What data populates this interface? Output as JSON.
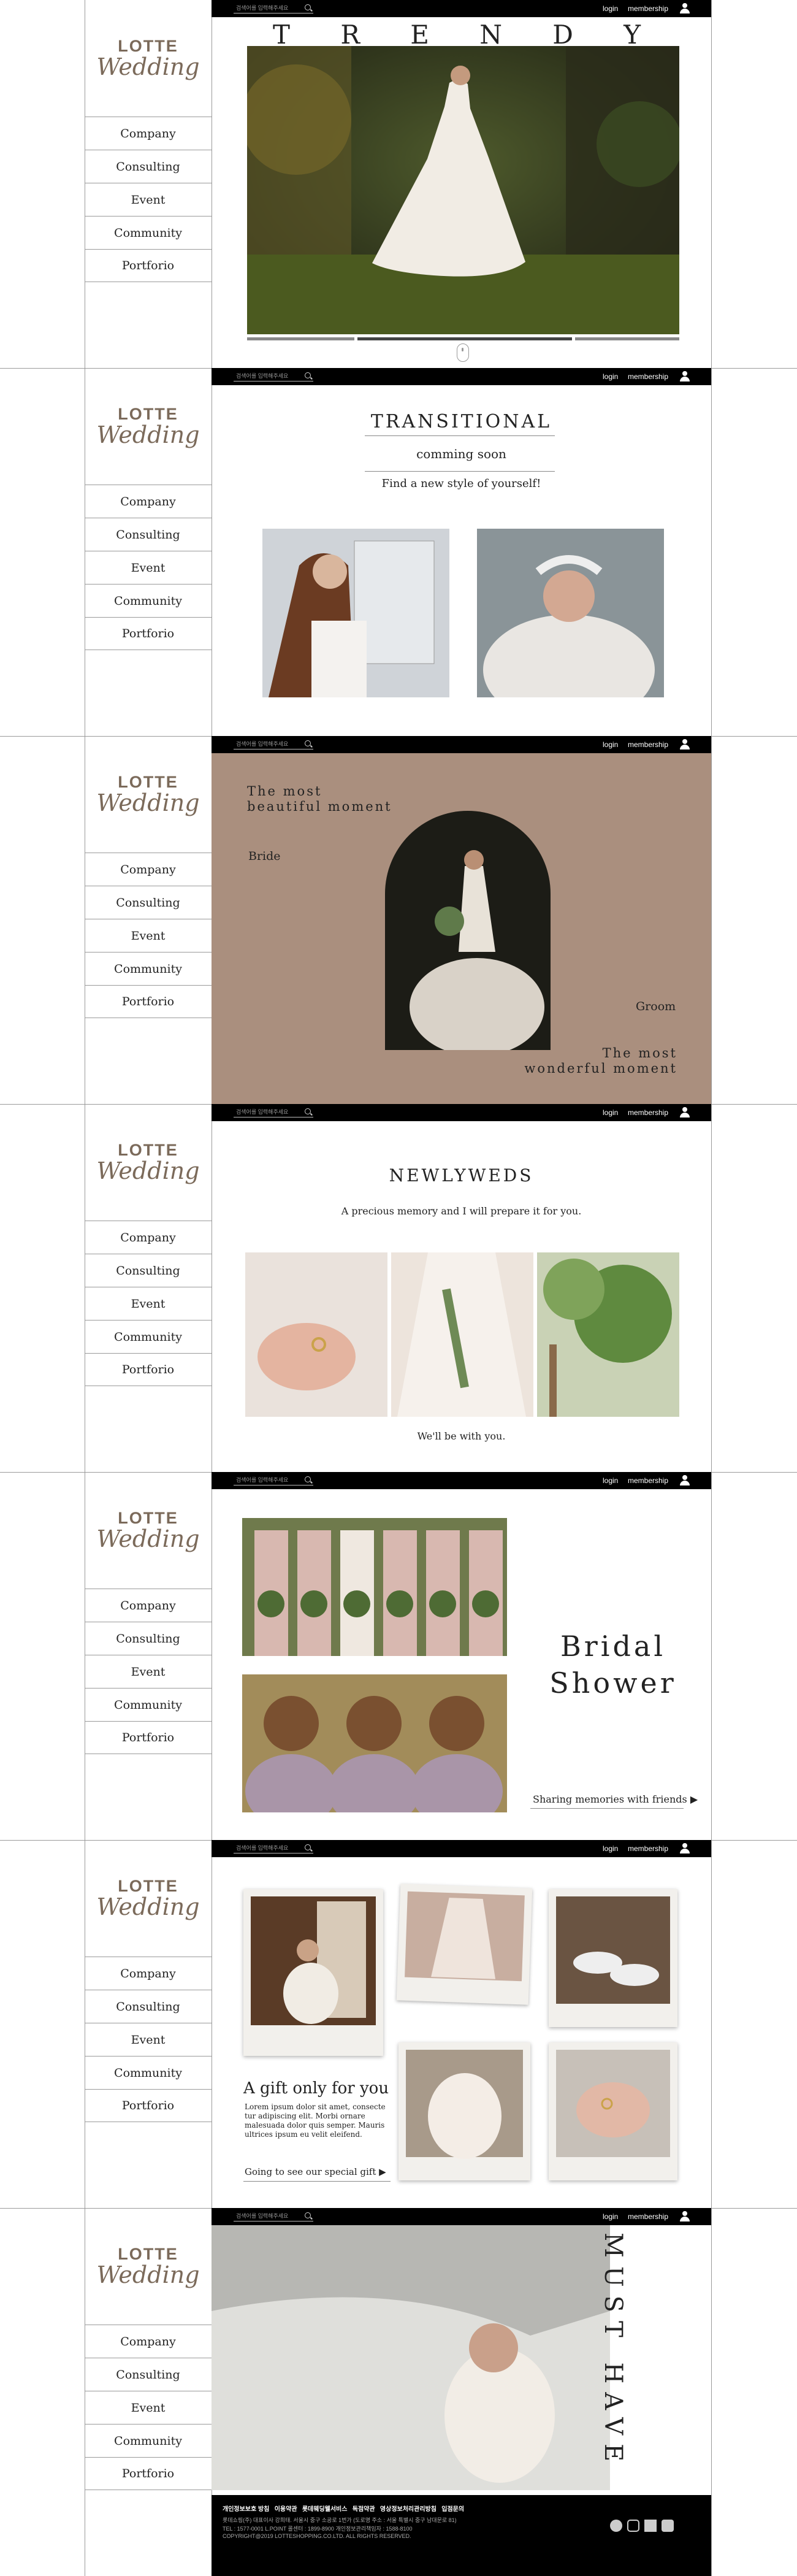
{
  "brand": {
    "line1": "LOTTE",
    "line2": "Wedding"
  },
  "menu": [
    "Company",
    "Consulting",
    "Event",
    "Community",
    "Portforio"
  ],
  "topbar": {
    "search_placeholder": "검색어를 입력해주세요",
    "login": "login",
    "membership": "membership"
  },
  "trendy": {
    "letters": [
      "T",
      "R",
      "E",
      "N",
      "D",
      "Y"
    ]
  },
  "transitional": {
    "title": "TRANSITIONAL",
    "subtitle": "comming soon",
    "tagline": "Find a new style of yourself!"
  },
  "moment": {
    "top": "The most\nbeautiful moment",
    "bride": "Bride",
    "groom": "Groom",
    "bottom": "The most\nwonderful moment"
  },
  "newlyweds": {
    "title": "NEWLYWEDS",
    "subtitle": "A precious memory and I will prepare it for you.",
    "footer": "We'll be with you."
  },
  "shower": {
    "title": "Bridal\nShower",
    "link": "Sharing memories with friends ▶"
  },
  "gift": {
    "title": "A gift only for you",
    "body": "Lorem ipsum dolor sit amet, consecte tur adipiscing elit. Morbi ornare malesuada dolor quis semper. Mauris ultrices ipsum eu velit eleifend.",
    "link": "Going to see our special gift ▶"
  },
  "musthave": {
    "vertical": "MUST HAVE"
  },
  "footer": {
    "links": "개인정보보호 방침   이용약관   롯데웨딩웰서비스   독점약관   영상정보처리관리방침   입점문의",
    "address": "롯데쇼핑(주) 대표이사 강희태. 서울시 중구 소공로 1번가 (도로명 주소 : 서울 특별시 중구 남대문로 81)",
    "tel": "TEL : 1577-0001  L.POINT 콜센터 : 1899-8900  개인정보관리책임자 : 1588-8100",
    "copyright": "COPYRIGHT@2019 LOTTESHOPPING.CO.LTD. ALL RIGHTS RESERVED."
  },
  "colors": {
    "brand": "#7b6a5a",
    "moment_bg": "#aa8f7e",
    "topbar": "#000000"
  }
}
